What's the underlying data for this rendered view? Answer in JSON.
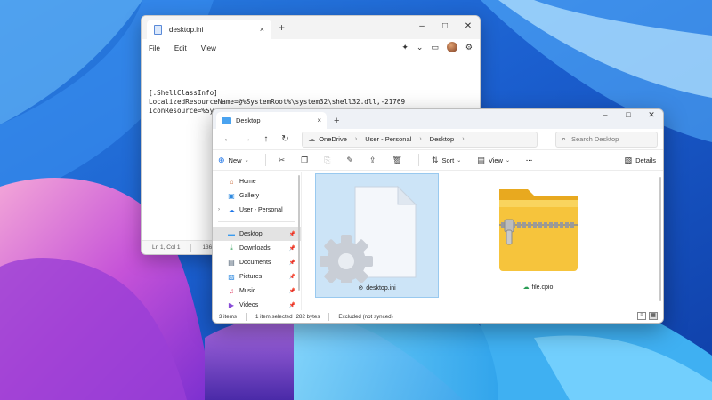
{
  "notepad": {
    "tab_title": "desktop.ini",
    "tab_close": "×",
    "new_tab": "+",
    "menus": [
      "File",
      "Edit",
      "View"
    ],
    "content_lines": [
      "[.ShellClassInfo]",
      "LocalizedResourceName=@%SystemRoot%\\system32\\shell32.dll,-21769",
      "IconResource=%SystemRoot%\\system32\\imageres.dll,-183"
    ],
    "status": {
      "position": "Ln 1, Col 1",
      "chars": "136 chara"
    }
  },
  "explorer": {
    "tab_title": "Desktop",
    "tab_close": "×",
    "new_tab": "+",
    "breadcrumb": [
      "OneDrive",
      "User - Personal",
      "Desktop"
    ],
    "search_placeholder": "Search Desktop",
    "toolbar": {
      "new_label": "New",
      "sort_label": "Sort",
      "view_label": "View",
      "more_label": "···",
      "details_label": "Details"
    },
    "sidebar": {
      "items": [
        {
          "label": "Home",
          "icon": "home-icon"
        },
        {
          "label": "Gallery",
          "icon": "gallery-icon"
        },
        {
          "label": "User - Personal",
          "icon": "onedrive-cloud-icon"
        },
        {
          "label": "Desktop",
          "icon": "desktop-folder-icon"
        },
        {
          "label": "Downloads",
          "icon": "downloads-icon"
        },
        {
          "label": "Documents",
          "icon": "documents-icon"
        },
        {
          "label": "Pictures",
          "icon": "pictures-icon"
        },
        {
          "label": "Music",
          "icon": "music-icon"
        },
        {
          "label": "Videos",
          "icon": "videos-icon"
        }
      ]
    },
    "files": [
      {
        "name": "desktop.ini",
        "selected": true,
        "icon": "settings-file-icon"
      },
      {
        "name": "file.cpio",
        "selected": false,
        "icon": "zip-folder-icon"
      }
    ],
    "status": {
      "items": "3 items",
      "selected": "1 item selected",
      "size": "282 bytes",
      "sync": "Excluded (not synced)"
    }
  },
  "colors": {
    "accent": "#1a73e8",
    "selection": "#cce4f7",
    "zip_folder": "#f6c43c"
  }
}
